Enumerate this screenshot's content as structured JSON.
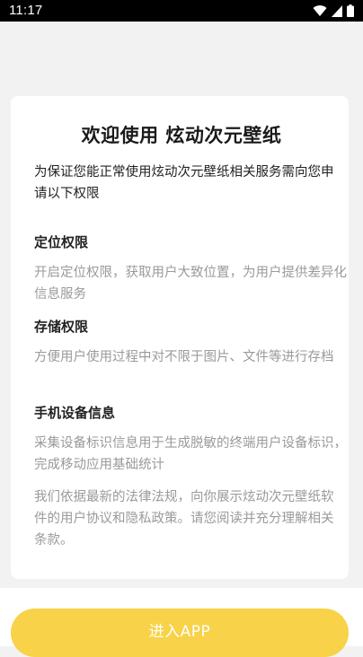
{
  "status_bar": {
    "time": "11:17",
    "icons": [
      "wifi-icon",
      "cell-signal-icon",
      "battery-icon"
    ]
  },
  "dialog": {
    "title": "欢迎使用 炫动次元壁纸",
    "intro": "为保证您能正常使用炫动次元壁纸相关服务需向您申请以下权限",
    "sections": [
      {
        "heading": "定位权限",
        "body": "开启定位权限，获取用户大致位置，为用户提供差异化信息服务"
      },
      {
        "heading": "存储权限",
        "body": "方便用户使用过程中对不限于图片、文件等进行存档"
      },
      {
        "heading": "手机设备信息",
        "body": "采集设备标识信息用于生成脱敏的终端用户设备标识，完成移动应用基础统计"
      }
    ],
    "notice": "我们依据最新的法律法规，向你展示炫动次元壁纸软件的用户协议和隐私政策。请您阅读并充分理解相关条款。"
  },
  "actions": {
    "enter_label": "进入APP"
  },
  "colors": {
    "accent": "#f8d248",
    "background": "#f2f2f2",
    "card": "#ffffff",
    "muted_text": "#9a9a9a"
  }
}
